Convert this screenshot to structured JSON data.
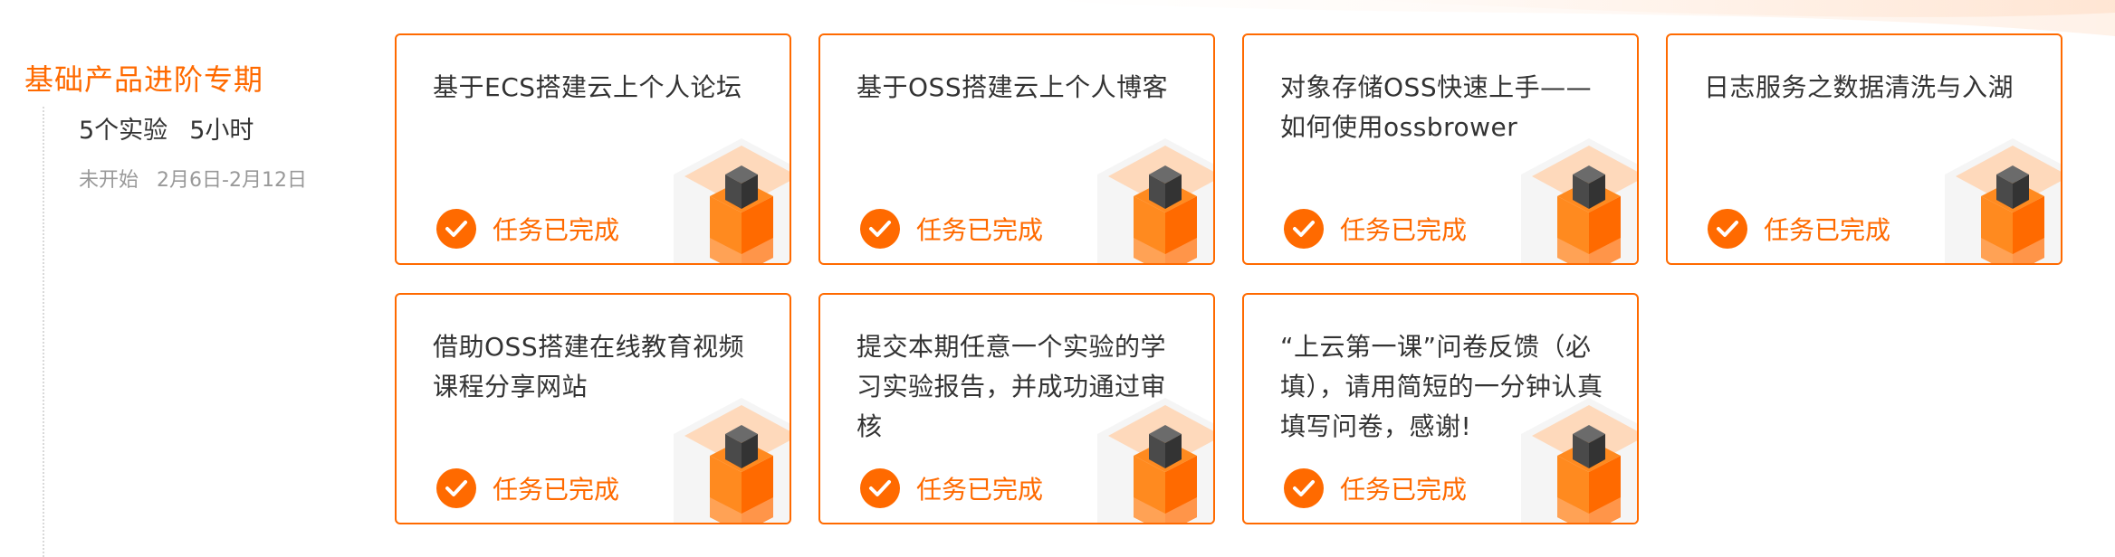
{
  "section": {
    "title": "基础产品进阶专期",
    "experiment_count": "5个实验",
    "duration": "5小时",
    "status": "未开始",
    "date_range": "2月6日-2月12日"
  },
  "cards": [
    {
      "title": "基于ECS搭建云上个人论坛",
      "status": "任务已完成"
    },
    {
      "title": "基于OSS搭建云上个人博客",
      "status": "任务已完成"
    },
    {
      "title": "对象存储OSS快速上手——如何使用ossbrower",
      "status": "任务已完成"
    },
    {
      "title": "日志服务之数据清洗与入湖",
      "status": "任务已完成"
    },
    {
      "title": "借助OSS搭建在线教育视频课程分享网站",
      "status": "任务已完成"
    },
    {
      "title": "提交本期任意一个实验的学习实验报告，并成功通过审核",
      "status": "任务已完成"
    },
    {
      "title": "“上云第一课”问卷反馈（必填），请用简短的一分钟认真填写问卷，感谢!",
      "status": "任务已完成"
    }
  ],
  "colors": {
    "accent": "#ff6a00",
    "text": "#333333",
    "muted": "#999999"
  },
  "icons": {
    "status": "check-circle-icon",
    "decoration": "cube-icon"
  }
}
